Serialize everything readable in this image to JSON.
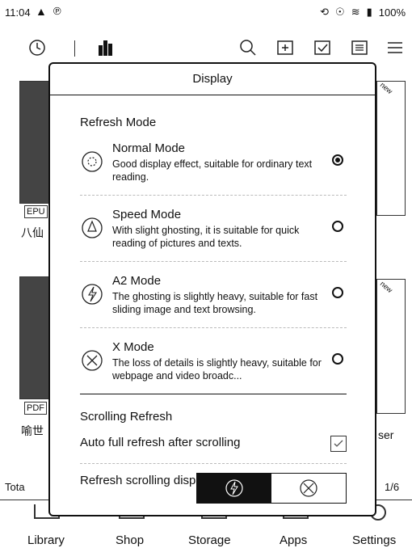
{
  "status": {
    "time": "11:04",
    "battery": "100%"
  },
  "background": {
    "badges": [
      "EPU",
      "PDF"
    ],
    "new_badges": [
      "new",
      "new"
    ],
    "title_fragments": [
      "八仙",
      "喻世"
    ],
    "right_text": "ser",
    "footer_left": "Tota",
    "page_indicator": "1/6"
  },
  "nav": {
    "items": [
      {
        "label": "Library",
        "icon": "library-icon"
      },
      {
        "label": "Shop",
        "icon": "shop-icon"
      },
      {
        "label": "Storage",
        "icon": "storage-icon"
      },
      {
        "label": "Apps",
        "icon": "apps-icon"
      },
      {
        "label": "Settings",
        "icon": "settings-icon"
      }
    ]
  },
  "panel": {
    "title": "Display",
    "refresh_mode_title": "Refresh Mode",
    "modes": [
      {
        "name": "Normal Mode",
        "desc": "Good display effect, suitable for ordinary text reading.",
        "selected": true
      },
      {
        "name": "Speed Mode",
        "desc": "With slight ghosting, it is suitable for quick reading of pictures and texts.",
        "selected": false
      },
      {
        "name": "A2 Mode",
        "desc": "The ghosting is slightly heavy, suitable for fast sliding image and text browsing.",
        "selected": false
      },
      {
        "name": "X Mode",
        "desc": "The loss of details is slightly heavy, suitable for webpage and video broadc...",
        "selected": false
      }
    ],
    "scrolling_title": "Scrolling Refresh",
    "auto_refresh_label": "Auto full refresh after scrolling",
    "auto_refresh_checked": false,
    "refresh_scroll_label": "Refresh scrolling display"
  }
}
